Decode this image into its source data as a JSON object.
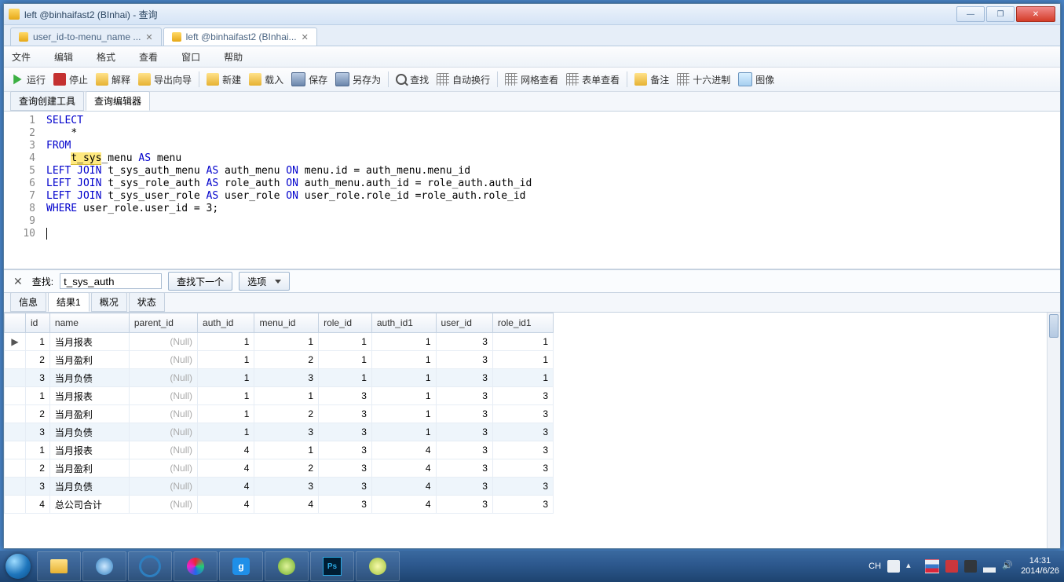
{
  "window": {
    "title": "left @binhaifast2 (BInhai) - 查询"
  },
  "doc_tabs": [
    {
      "label": "user_id-to-menu_name ..."
    },
    {
      "label": "left @binhaifast2 (BInhai..."
    }
  ],
  "menu": {
    "file": "文件",
    "edit": "编辑",
    "format": "格式",
    "view": "查看",
    "window": "窗口",
    "help": "帮助"
  },
  "toolbar": {
    "run": "运行",
    "stop": "停止",
    "explain": "解释",
    "export": "导出向导",
    "new": "新建",
    "load": "载入",
    "save": "保存",
    "saveas": "另存为",
    "find": "查找",
    "wrap": "自动换行",
    "gridview": "网格查看",
    "formview": "表单查看",
    "note": "备注",
    "hex": "十六进制",
    "image": "图像"
  },
  "sub_tabs": {
    "builder": "查询创建工具",
    "editor": "查询编辑器"
  },
  "sql": {
    "l1a": "SELECT",
    "l2a": "*",
    "l3a": "FROM",
    "l4_hl": "t_sys",
    "l4_rest": "_menu ",
    "l4_as": "AS",
    "l4_tail": " menu",
    "l5a": "LEFT",
    "l5b": "JOIN",
    "l5c": " t_sys_auth_menu ",
    "l5d": "AS",
    "l5e": " auth_menu ",
    "l5f": "ON",
    "l5g": " menu.id = auth_menu.menu_id",
    "l6a": "LEFT",
    "l6b": "JOIN",
    "l6c": " t_sys_role_auth ",
    "l6d": "AS",
    "l6e": " role_auth ",
    "l6f": "ON",
    "l6g": " auth_menu.auth_id = role_auth.auth_id",
    "l7a": "LEFT",
    "l7b": "JOIN",
    "l7c": " t_sys_user_role ",
    "l7d": "AS",
    "l7e": " user_role ",
    "l7f": "ON",
    "l7g": " user_role.role_id =role_auth.role_id",
    "l8a": "WHERE",
    "l8b": " user_role.user_id = 3;"
  },
  "find": {
    "label": "查找:",
    "value": "t_sys_auth",
    "next": "查找下一个",
    "options": "选项"
  },
  "result_tabs": {
    "info": "信息",
    "r1": "结果1",
    "profile": "概况",
    "status": "状态"
  },
  "columns": [
    "",
    "id",
    "name",
    "parent_id",
    "auth_id",
    "menu_id",
    "role_id",
    "auth_id1",
    "user_id",
    "role_id1"
  ],
  "rows": [
    {
      "ptr": "▶",
      "id": 1,
      "name": "当月报表",
      "parent_id": "(Null)",
      "auth_id": 1,
      "menu_id": 1,
      "role_id": 1,
      "auth_id1": 1,
      "user_id": 3,
      "role_id1": 1
    },
    {
      "ptr": "",
      "id": 2,
      "name": "当月盈利",
      "parent_id": "(Null)",
      "auth_id": 1,
      "menu_id": 2,
      "role_id": 1,
      "auth_id1": 1,
      "user_id": 3,
      "role_id1": 1
    },
    {
      "ptr": "",
      "id": 3,
      "name": "当月负债",
      "parent_id": "(Null)",
      "auth_id": 1,
      "menu_id": 3,
      "role_id": 1,
      "auth_id1": 1,
      "user_id": 3,
      "role_id1": 1
    },
    {
      "ptr": "",
      "id": 1,
      "name": "当月报表",
      "parent_id": "(Null)",
      "auth_id": 1,
      "menu_id": 1,
      "role_id": 3,
      "auth_id1": 1,
      "user_id": 3,
      "role_id1": 3
    },
    {
      "ptr": "",
      "id": 2,
      "name": "当月盈利",
      "parent_id": "(Null)",
      "auth_id": 1,
      "menu_id": 2,
      "role_id": 3,
      "auth_id1": 1,
      "user_id": 3,
      "role_id1": 3
    },
    {
      "ptr": "",
      "id": 3,
      "name": "当月负债",
      "parent_id": "(Null)",
      "auth_id": 1,
      "menu_id": 3,
      "role_id": 3,
      "auth_id1": 1,
      "user_id": 3,
      "role_id1": 3
    },
    {
      "ptr": "",
      "id": 1,
      "name": "当月报表",
      "parent_id": "(Null)",
      "auth_id": 4,
      "menu_id": 1,
      "role_id": 3,
      "auth_id1": 4,
      "user_id": 3,
      "role_id1": 3
    },
    {
      "ptr": "",
      "id": 2,
      "name": "当月盈利",
      "parent_id": "(Null)",
      "auth_id": 4,
      "menu_id": 2,
      "role_id": 3,
      "auth_id1": 4,
      "user_id": 3,
      "role_id1": 3
    },
    {
      "ptr": "",
      "id": 3,
      "name": "当月负债",
      "parent_id": "(Null)",
      "auth_id": 4,
      "menu_id": 3,
      "role_id": 3,
      "auth_id1": 4,
      "user_id": 3,
      "role_id1": 3
    },
    {
      "ptr": "",
      "id": 4,
      "name": "总公司合计",
      "parent_id": "(Null)",
      "auth_id": 4,
      "menu_id": 4,
      "role_id": 3,
      "auth_id1": 4,
      "user_id": 3,
      "role_id1": 3
    }
  ],
  "tray": {
    "ime": "CH",
    "time": "14:31",
    "date": "2014/6/26"
  }
}
